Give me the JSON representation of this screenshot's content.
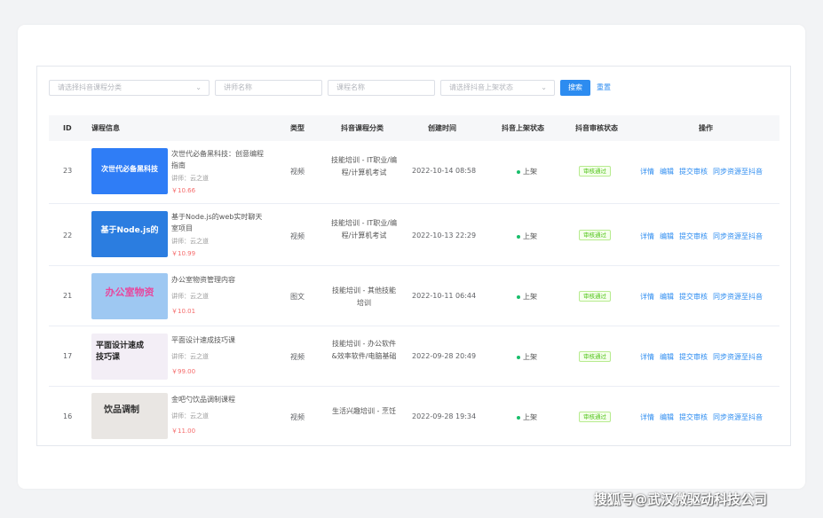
{
  "filters": {
    "category_placeholder": "请选择抖音课程分类",
    "lecturer_placeholder": "讲师名称",
    "course_placeholder": "课程名称",
    "status_placeholder": "请选择抖音上架状态",
    "search_label": "搜索",
    "reset_label": "重置"
  },
  "table": {
    "headers": {
      "id": "ID",
      "info": "课程信息",
      "type": "类型",
      "category": "抖音课程分类",
      "created": "创建时间",
      "listing": "抖音上架状态",
      "review": "抖音审核状态",
      "actions": "操作"
    },
    "rows": [
      {
        "id": "23",
        "title": "次世代必备黑科技：创意编程指南",
        "lecturer": "讲师：云之道",
        "price": "￥10.66",
        "type": "视频",
        "category": "技能培训 - IT职业/编程/计算机考试",
        "created": "2022-10-14 08:58",
        "listing": "上架",
        "review": "审核通过",
        "thumb_text": "次世代必备黑科技",
        "thumb_color": "#2f7df6"
      },
      {
        "id": "22",
        "title": "基于Node.js的web实时聊天室项目",
        "lecturer": "讲师：云之道",
        "price": "￥10.99",
        "type": "视频",
        "category": "技能培训 - IT职业/编程/计算机考试",
        "created": "2022-10-13 22:29",
        "listing": "上架",
        "review": "审核通过",
        "thumb_text": "基于Node.js的",
        "thumb_color": "#2b7de0"
      },
      {
        "id": "21",
        "title": "办公室物资管理内容",
        "lecturer": "讲师：云之道",
        "price": "￥10.01",
        "type": "图文",
        "category": "技能培训 - 其他技能培训",
        "created": "2022-10-11 06:44",
        "listing": "上架",
        "review": "审核通过",
        "thumb_text": "办公室物资",
        "thumb_color": "#9ec8f2"
      },
      {
        "id": "17",
        "title": "平面设计速成技巧课",
        "lecturer": "讲师：云之道",
        "price": "￥99.00",
        "type": "视频",
        "category": "技能培训 - 办公软件&效率软件/电脑基础",
        "created": "2022-09-28 20:49",
        "listing": "上架",
        "review": "审核通过",
        "thumb_text": "平面设计速成技巧课",
        "thumb_color": "#f3eef6"
      },
      {
        "id": "16",
        "title": "金吧勺饮品调制课程",
        "lecturer": "讲师：云之道",
        "price": "￥11.00",
        "type": "视频",
        "category": "生活兴趣培训 - 烹饪",
        "created": "2022-09-28 19:34",
        "listing": "上架",
        "review": "审核通过",
        "thumb_text": "饮品调制",
        "thumb_color": "#e9e6e3"
      }
    ],
    "action_labels": [
      "详情",
      "编辑",
      "提交审核",
      "同步资源至抖音"
    ]
  },
  "watermark": "搜狐号@武汉微驱动科技公司",
  "colors": {
    "primary": "#2d8cf0",
    "success": "#52c41a",
    "price": "#f56c6c",
    "status_dot": "#19be6b"
  }
}
